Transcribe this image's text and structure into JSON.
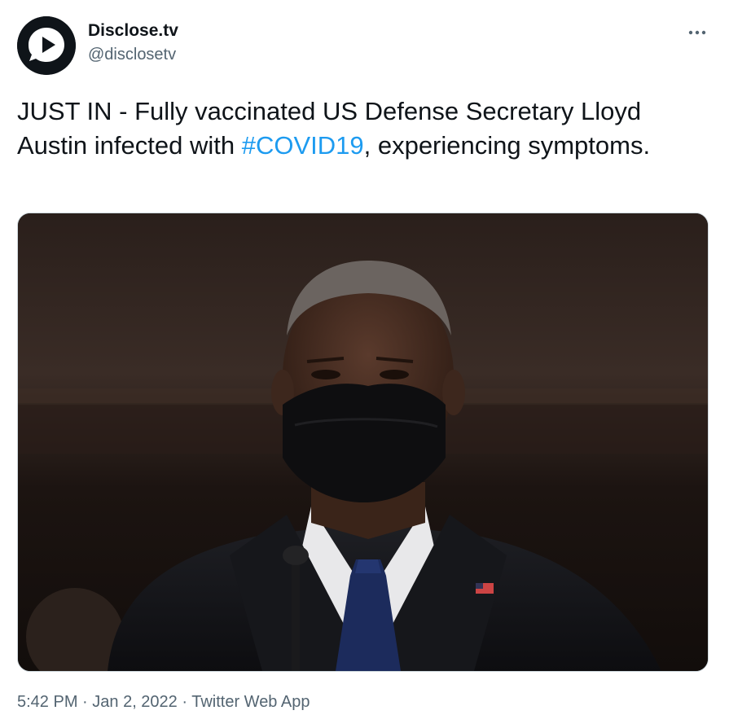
{
  "author": {
    "name": "Disclose.tv",
    "handle": "@disclosetv",
    "avatar_icon": "play-in-speech-bubble-logo"
  },
  "more_icon": "more-horizontal-icon",
  "tweet": {
    "text_before": "JUST IN - Fully vaccinated US Defense Secretary Lloyd Austin infected with ",
    "hashtag": "#COVID19",
    "text_after": ", experiencing symptoms."
  },
  "media": {
    "description_icon": "photo-man-in-black-mask"
  },
  "meta": {
    "time": "5:42 PM",
    "separator": " · ",
    "date": "Jan 2, 2022",
    "source": "Twitter Web App"
  },
  "colors": {
    "text": "#0f1419",
    "secondary": "#536471",
    "link": "#1d9bf0"
  }
}
